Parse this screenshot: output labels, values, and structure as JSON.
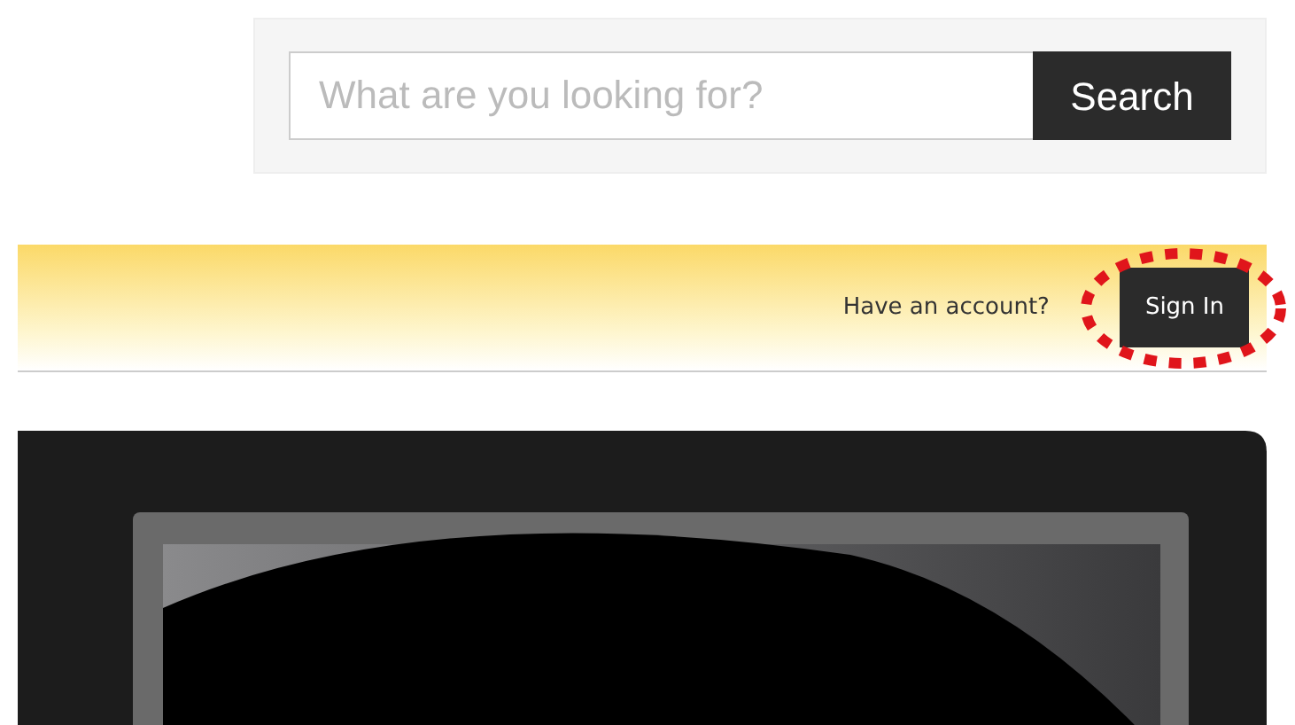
{
  "search": {
    "placeholder": "What are you looking for?",
    "button": "Search"
  },
  "account_bar": {
    "prompt": "Have an account?",
    "sign_in": {
      "label": "Sign In",
      "highlighted": true
    }
  },
  "banner": {
    "kind": "monitor"
  }
}
